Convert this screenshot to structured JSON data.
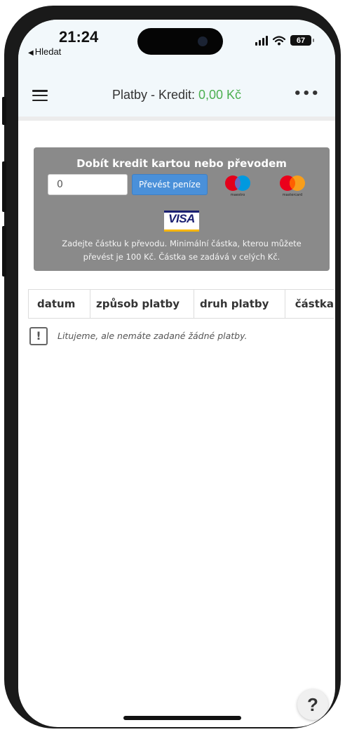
{
  "status_bar": {
    "time": "21:24",
    "back_app": "Hledat",
    "battery": "67"
  },
  "header": {
    "title_prefix": "Platby - Kredit: ",
    "credit": "0,00 Kč"
  },
  "topup": {
    "title": "Dobít kredit kartou nebo převodem",
    "amount_value": "0",
    "transfer_button": "Převést peníze",
    "maestro_label": "maestro",
    "mastercard_label": "mastercard",
    "visa_label": "VISA",
    "note_line1": "Zadejte částku k převodu. Minimální částka, kterou můžete",
    "note_line2": "převést je 100 Kč. Částka se zadává v celých Kč."
  },
  "table": {
    "columns": [
      "datum",
      "způsob platby",
      "druh platby",
      "částka"
    ]
  },
  "empty_message": "Litujeme, ale nemáte zadané žádné platby.",
  "help": {
    "label": "?"
  },
  "colors": {
    "credit_green": "#4caf50",
    "panel_gray": "#8a8a8a",
    "button_blue": "#4a90d9"
  }
}
